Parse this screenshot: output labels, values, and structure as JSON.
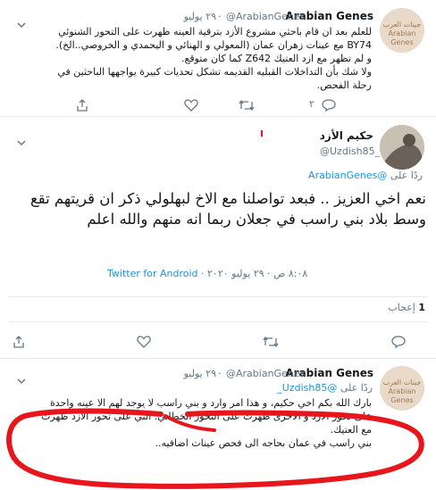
{
  "tweet1": {
    "author_name": "Arabian Genes",
    "author_handle": "@ArabianGenes",
    "date": "۲۹ يوليو",
    "lines": [
      "للعلم بعد ان قام باحثي مشروع الأزد بترقية العينه ظهرت على التحور الشنوئي",
      "BY74 مع عينات زهران عمان (المعولي و الهنائي و اليحمدي و الخروصي..الخ).",
      "و لم تظهر مع ازد العتيك Z642 كما كان متوقع.",
      "ولا شك بأن التداخلات القبليه القديمه تشكل تحديات كبيرة يواجهها الباحثين في",
      "رحلة الفحص."
    ],
    "reply_count": "۲",
    "retweet_count": "",
    "like_count": "",
    "avatar_text": "جينات العرب Arabian Genes"
  },
  "tweet2": {
    "author_name": "حكيم الأزد",
    "author_handle": "@Uzdish85_",
    "replying_label": "ردًا على",
    "replying_to": "@ArabianGenes",
    "body": "نعم اخي العزيز .. فبعد تواصلنا مع الاخ لبهلولي ذكر ان قريتهم تقع وسط بلاد بني راسب في جعلان ربما انه منهم والله اعلم",
    "time_date": "٨:٠٨ ص · ٢٩ يوليو ٢٠٢٠",
    "source": "Twitter for Android",
    "likes_count": "1",
    "likes_label": "إعجاب"
  },
  "tweet3": {
    "author_name": "Arabian Genes",
    "author_handle": "@ArabianGenes",
    "date": "۲۹ يوليو",
    "replying_label": "ردًا على",
    "replying_to": "@Uzdish85_",
    "lines": [
      "بارك الله بكم اخي حكيم، و هذا امر وارد و بني راسب لا يوجد لهم الا عينه واحدة",
      "على تحور الازد و الاخرى ظهرت على التحور الخطاني. التي على تحور الازد ظهرت",
      "مع العتيك.",
      "بني راسب في عمان بحاجه الى فحص عينات اضافيه.."
    ],
    "avatar_text": "جينات العرب Arabian Genes"
  },
  "colors": {
    "link": "#1b95e0",
    "grey": "#657786",
    "annotation": "#e8161c"
  }
}
